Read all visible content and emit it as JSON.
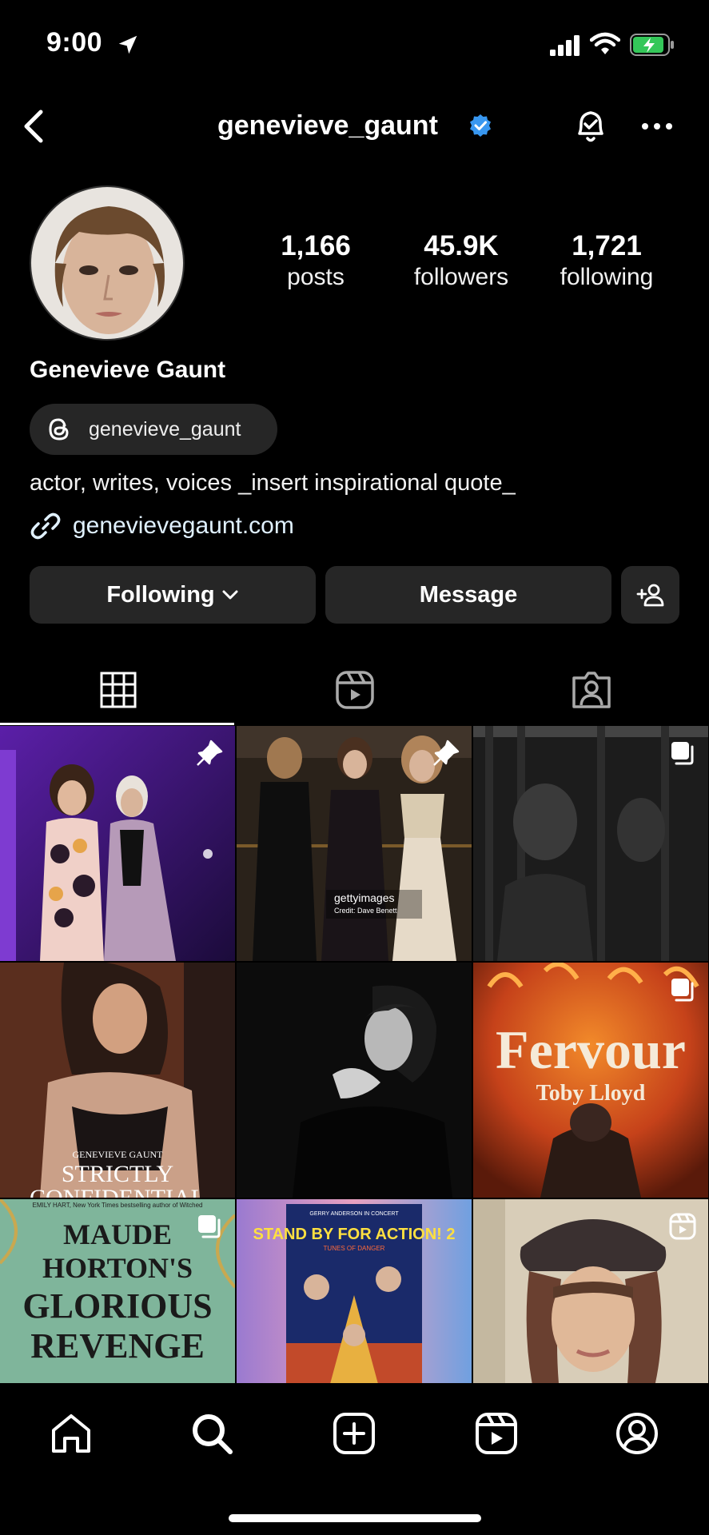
{
  "status_bar": {
    "time": "9:00"
  },
  "header": {
    "username": "genevieve_gaunt"
  },
  "profile": {
    "stats": [
      {
        "value": "1,166",
        "label": "posts"
      },
      {
        "value": "45.9K",
        "label": "followers"
      },
      {
        "value": "1,721",
        "label": "following"
      }
    ],
    "full_name": "Genevieve Gaunt",
    "threads_handle": "genevieve_gaunt",
    "bio": "actor, writes, voices _insert inspirational quote_",
    "website": "genevievegaunt.com"
  },
  "actions": {
    "following_label": "Following",
    "message_label": "Message"
  },
  "posts": [
    {
      "kind": "pinned",
      "overlay": ""
    },
    {
      "kind": "pinned",
      "overlay": "gettyimages\nCredit: Dave Benett"
    },
    {
      "kind": "carousel",
      "overlay": ""
    },
    {
      "kind": "photo",
      "overlay": "GENEVIEVE GAUNT\nSTRICTLY\nCONFIDENTIAL"
    },
    {
      "kind": "photo",
      "overlay": ""
    },
    {
      "kind": "carousel",
      "overlay": "Fervour\nToby Lloyd"
    },
    {
      "kind": "carousel",
      "overlay": "MAUDE HORTON'S GLORIOUS REVENGE"
    },
    {
      "kind": "photo",
      "overlay": "STAND BY FOR ACTION! 2"
    },
    {
      "kind": "reel",
      "overlay": ""
    }
  ],
  "cover_texts": {
    "getty_logo": "gettyimages",
    "getty_credit": "Credit: Dave Benett",
    "strictly_author": "GENEVIEVE GAUNT",
    "strictly_title": "STRICTLY",
    "strictly_sub": "CONFIDENTIAL",
    "fervour_title": "Fervour",
    "fervour_author": "Toby Lloyd",
    "maude_tag": "EMILY HART, New York Times bestselling author of Witched",
    "maude_line1": "MAUDE",
    "maude_line2": "HORTON'S",
    "maude_line3": "GLORIOUS",
    "maude_line4": "REVENGE",
    "standby_top": "GERRY ANDERSON IN CONCERT",
    "standby_title": "STAND BY FOR ACTION! 2",
    "standby_sub": "TUNES OF DANGER"
  },
  "colors": {
    "background": "#000000",
    "button_bg": "#262626",
    "verified": "#3897f0",
    "battery": "#34c759"
  }
}
